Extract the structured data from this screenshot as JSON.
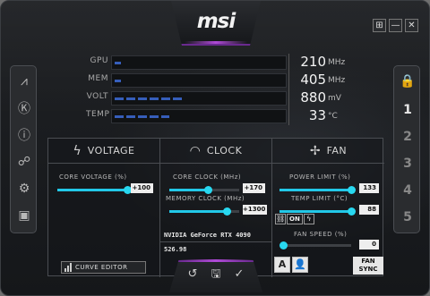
{
  "app": {
    "logo": "msi"
  },
  "window_buttons": [
    "⊞",
    "—",
    "✕"
  ],
  "left_rail": [
    {
      "name": "kombustor-icon",
      "glyph": "⩘"
    },
    {
      "name": "k-boost-icon",
      "glyph": "Ⓚ"
    },
    {
      "name": "info-icon",
      "glyph": "ⓘ"
    },
    {
      "name": "oc-scanner-icon",
      "glyph": "☍"
    },
    {
      "name": "settings-icon",
      "glyph": "⚙"
    },
    {
      "name": "monitor-icon",
      "glyph": "▣"
    }
  ],
  "right_rail": {
    "lock_icon": "🔒",
    "profiles": [
      "1",
      "2",
      "3",
      "4",
      "5"
    ]
  },
  "monitor": [
    {
      "label": "GPU",
      "value": "210",
      "unit": "MHz",
      "fill": 0.04
    },
    {
      "label": "MEM",
      "value": "405",
      "unit": "MHz",
      "fill": 0.04
    },
    {
      "label": "VOLT",
      "value": "880",
      "unit": "mV",
      "fill": 0.42
    },
    {
      "label": "TEMP",
      "value": "33",
      "unit": "°C",
      "fill": 0.33
    }
  ],
  "voltage": {
    "title": "VOLTAGE",
    "core_voltage_label": "CORE VOLTAGE  (%)",
    "core_voltage_value": "+100",
    "core_voltage_level": 1.0,
    "curve_editor": "CURVE EDITOR"
  },
  "clock": {
    "title": "CLOCK",
    "core_clock_label": "CORE CLOCK (MHz)",
    "core_clock_value": "+170",
    "memory_clock_label": "MEMORY CLOCK (MHz)",
    "memory_clock_value": "+1300",
    "gpu_name": "NVIDIA GeForce RTX 4090",
    "driver_version": "526.98"
  },
  "fan": {
    "title": "FAN",
    "power_limit_label": "POWER LIMIT (%)",
    "power_limit_value": "133",
    "temp_limit_label": "TEMP LIMIT (°C)",
    "temp_limit_value": "88",
    "link_on": "ON",
    "fan_speed_label": "FAN SPEED (%)",
    "fan_speed_value": "0",
    "auto_label": "A",
    "fan_sync_line1": "FAN",
    "fan_sync_line2": "SYNC"
  },
  "actions": {
    "reset": "↺",
    "save": "🖫",
    "apply": "✓"
  },
  "colors": {
    "accent": "#22c8e8",
    "glow": "#b04ad8",
    "bar": "#3d6cd8"
  }
}
